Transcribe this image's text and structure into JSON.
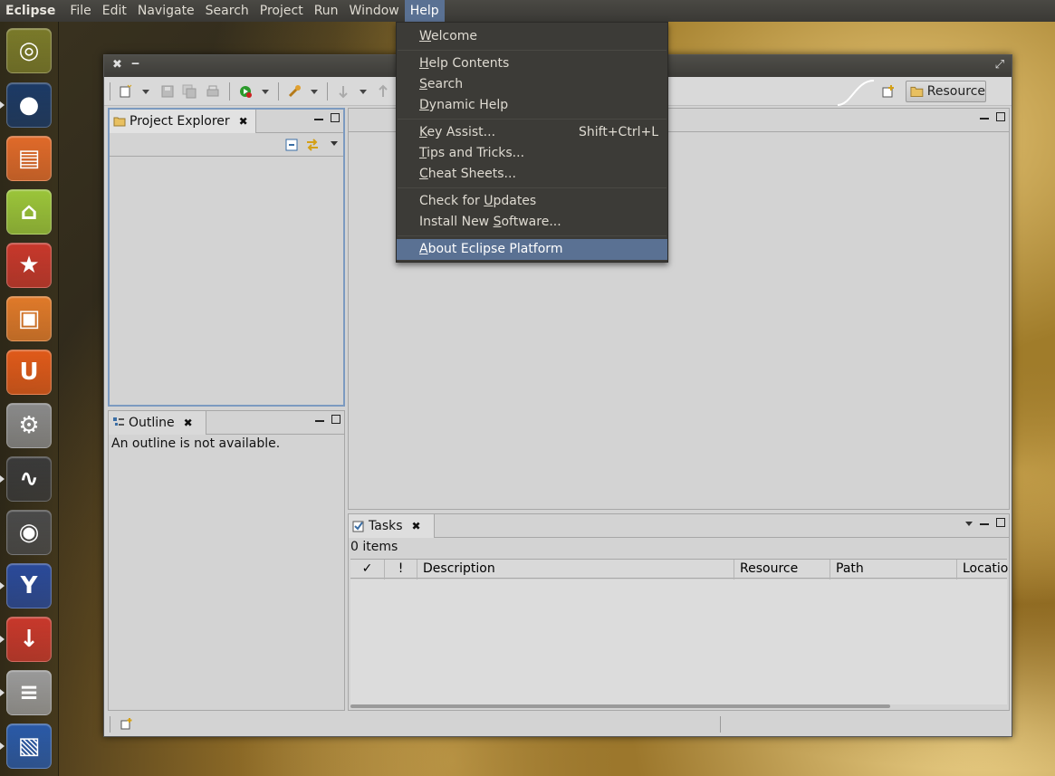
{
  "menubar": {
    "app_name": "Eclipse",
    "items": [
      "File",
      "Edit",
      "Navigate",
      "Search",
      "Project",
      "Run",
      "Window",
      "Help"
    ],
    "active_item": "Help"
  },
  "launcher": {
    "items": [
      {
        "name": "dash-home",
        "glyph": "◎",
        "color": "#7a7a2a"
      },
      {
        "name": "browser",
        "glyph": "●",
        "color": "#1c3a66"
      },
      {
        "name": "files",
        "glyph": "▤",
        "color": "#e06a2a"
      },
      {
        "name": "android-sdk",
        "glyph": "⌂",
        "color": "#9bc53a"
      },
      {
        "name": "wunderlist",
        "glyph": "★",
        "color": "#c8382c"
      },
      {
        "name": "software-center",
        "glyph": "▣",
        "color": "#e07a2a"
      },
      {
        "name": "ubuntu-one",
        "glyph": "U",
        "color": "#e05a1a"
      },
      {
        "name": "settings",
        "glyph": "⚙",
        "color": "#8a8a8a"
      },
      {
        "name": "system-monitor",
        "glyph": "∿",
        "color": "#3a3a3a"
      },
      {
        "name": "steam",
        "glyph": "◉",
        "color": "#4a4a4a"
      },
      {
        "name": "y-ppa-manager",
        "glyph": "Y",
        "color": "#2a4a9a"
      },
      {
        "name": "update-manager",
        "glyph": "↓",
        "color": "#c8382c"
      },
      {
        "name": "mixer",
        "glyph": "≡",
        "color": "#9a9a9a"
      },
      {
        "name": "virtualbox",
        "glyph": "▧",
        "color": "#2a5aa8"
      }
    ]
  },
  "window": {
    "close_glyph": "✖",
    "minimize_glyph": "‒",
    "maximize_glyph": "⤢"
  },
  "perspective": {
    "label": "Resource"
  },
  "project_explorer": {
    "title": "Project Explorer",
    "close_glyph": "✖"
  },
  "outline": {
    "title": "Outline",
    "close_glyph": "✖",
    "message": "An outline is not available."
  },
  "tasks": {
    "title": "Tasks",
    "close_glyph": "✖",
    "count": "0 items",
    "columns": [
      "✓",
      "!",
      "Description",
      "Resource",
      "Path",
      "Locatio"
    ]
  },
  "help_menu": {
    "items": [
      {
        "label_pre": "",
        "mnemonic": "W",
        "label_post": "elcome",
        "accel": ""
      },
      {
        "label_pre": "",
        "mnemonic": "H",
        "label_post": "elp Contents",
        "accel": ""
      },
      {
        "label_pre": "",
        "mnemonic": "S",
        "label_post": "earch",
        "accel": ""
      },
      {
        "label_pre": "",
        "mnemonic": "D",
        "label_post": "ynamic Help",
        "accel": ""
      },
      {
        "label_pre": "",
        "mnemonic": "K",
        "label_post": "ey Assist...",
        "accel": "Shift+Ctrl+L"
      },
      {
        "label_pre": "",
        "mnemonic": "T",
        "label_post": "ips and Tricks...",
        "accel": ""
      },
      {
        "label_pre": "",
        "mnemonic": "C",
        "label_post": "heat Sheets...",
        "accel": ""
      },
      {
        "label_pre": "Check for ",
        "mnemonic": "U",
        "label_post": "pdates",
        "accel": ""
      },
      {
        "label_pre": "Install New ",
        "mnemonic": "S",
        "label_post": "oftware...",
        "accel": ""
      },
      {
        "label_pre": "",
        "mnemonic": "A",
        "label_post": "bout Eclipse Platform",
        "accel": ""
      }
    ],
    "highlighted_index": 9
  },
  "colors": {
    "menu_bg": "#3c3b37",
    "menu_highlight": "#5a7193",
    "eclipse_bg": "#d3d3d3"
  }
}
